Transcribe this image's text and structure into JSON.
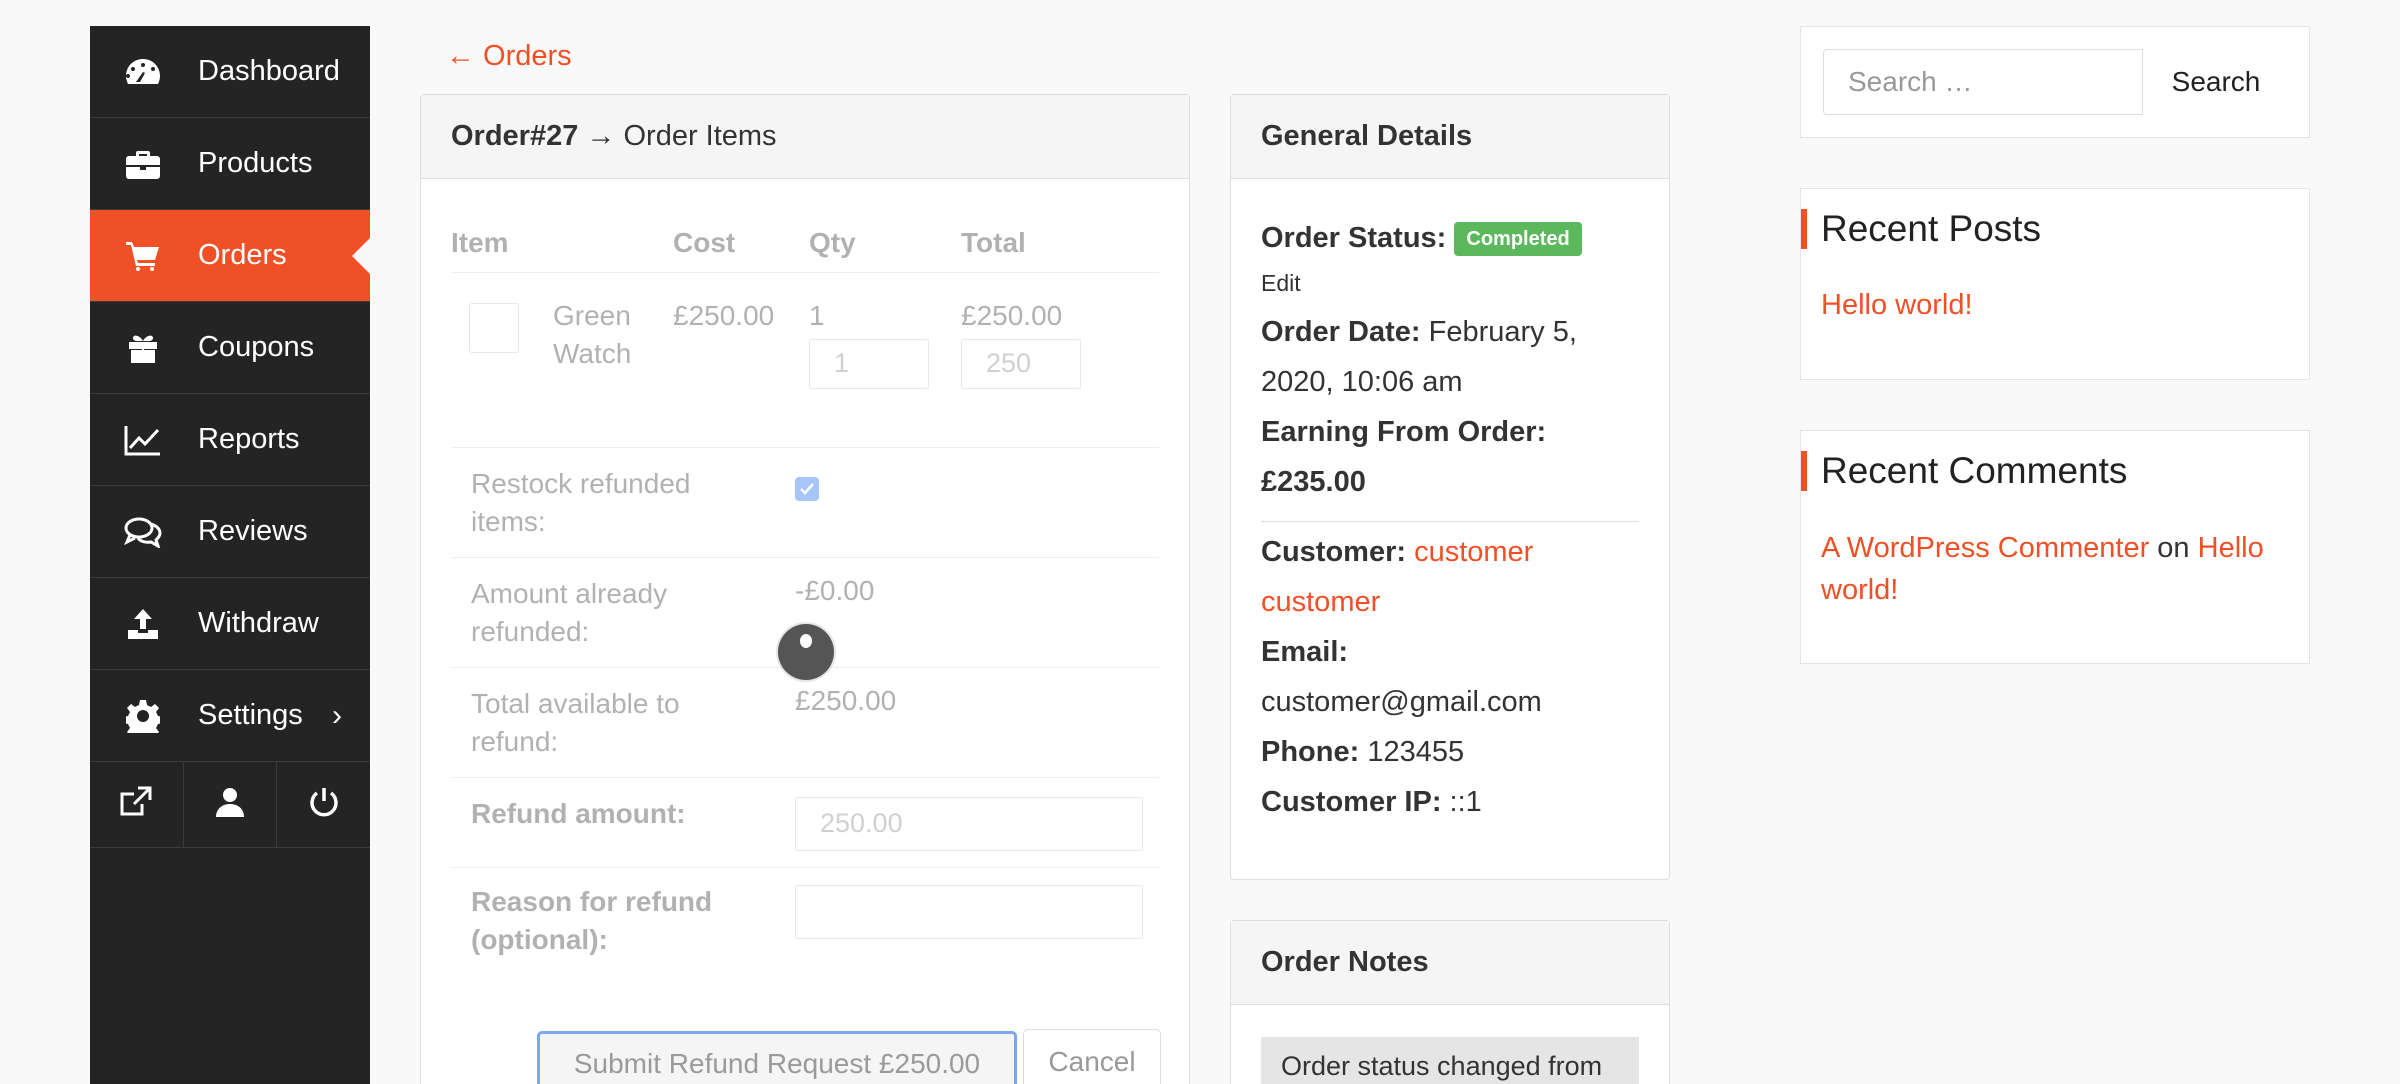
{
  "sidebar": {
    "items": [
      {
        "label": "Dashboard",
        "icon": "dashboard-icon"
      },
      {
        "label": "Products",
        "icon": "briefcase-icon"
      },
      {
        "label": "Orders",
        "icon": "cart-icon"
      },
      {
        "label": "Coupons",
        "icon": "gift-icon"
      },
      {
        "label": "Reports",
        "icon": "chart-line-icon"
      },
      {
        "label": "Reviews",
        "icon": "comments-icon"
      },
      {
        "label": "Withdraw",
        "icon": "upload-icon"
      },
      {
        "label": "Settings",
        "icon": "gear-icon",
        "chevron": "›"
      }
    ],
    "active": "Orders",
    "bottom_icons": [
      "external-link-icon",
      "user-icon",
      "power-icon"
    ]
  },
  "back_link": "← Orders",
  "order_items": {
    "title_bold": "Order#27",
    "title_rest": " → Order Items",
    "columns": [
      "Item",
      "Cost",
      "Qty",
      "Total"
    ],
    "row": {
      "product": "Green Watch",
      "cost": "£250.00",
      "qty": "1",
      "qty_input": "1",
      "total": "£250.00",
      "total_input": "250"
    },
    "restock_label": "Restock refunded items:",
    "restock_checked": true,
    "already_refunded_label": "Amount already refunded:",
    "already_refunded_value": "-£0.00",
    "available_label": "Total available to refund:",
    "available_value": "£250.00",
    "refund_amount_label": "Refund amount:",
    "refund_amount_value": "250.00",
    "reason_label": "Reason for refund (optional):",
    "reason_value": "",
    "submit_label": "Submit Refund Request £250.00",
    "cancel_label": "Cancel"
  },
  "general_details": {
    "title": "General Details",
    "status_label": "Order Status:",
    "status_value": "Completed",
    "status_color": "#5cb85c",
    "edit_label": "Edit",
    "date_label": "Order Date:",
    "date_value": "February 5, 2020, 10:06 am",
    "earning_label": "Earning From Order:",
    "earning_value": "£235.00",
    "customer_label": "Customer:",
    "customer_value": "customer customer",
    "email_label": "Email:",
    "email_value": "customer@gmail.com",
    "phone_label": "Phone:",
    "phone_value": "123455",
    "ip_label": "Customer IP:",
    "ip_value": "::1"
  },
  "order_notes": {
    "title": "Order Notes",
    "first_note": "Order status changed from"
  },
  "search": {
    "placeholder": "Search …",
    "button": "Search"
  },
  "recent_posts": {
    "title": "Recent Posts",
    "items": [
      "Hello world!"
    ]
  },
  "recent_comments": {
    "title": "Recent Comments",
    "author": "A WordPress Commenter",
    "on": "on",
    "post": "Hello world!"
  },
  "colors": {
    "accent": "#f05025",
    "sidebar_bg": "#242424"
  }
}
